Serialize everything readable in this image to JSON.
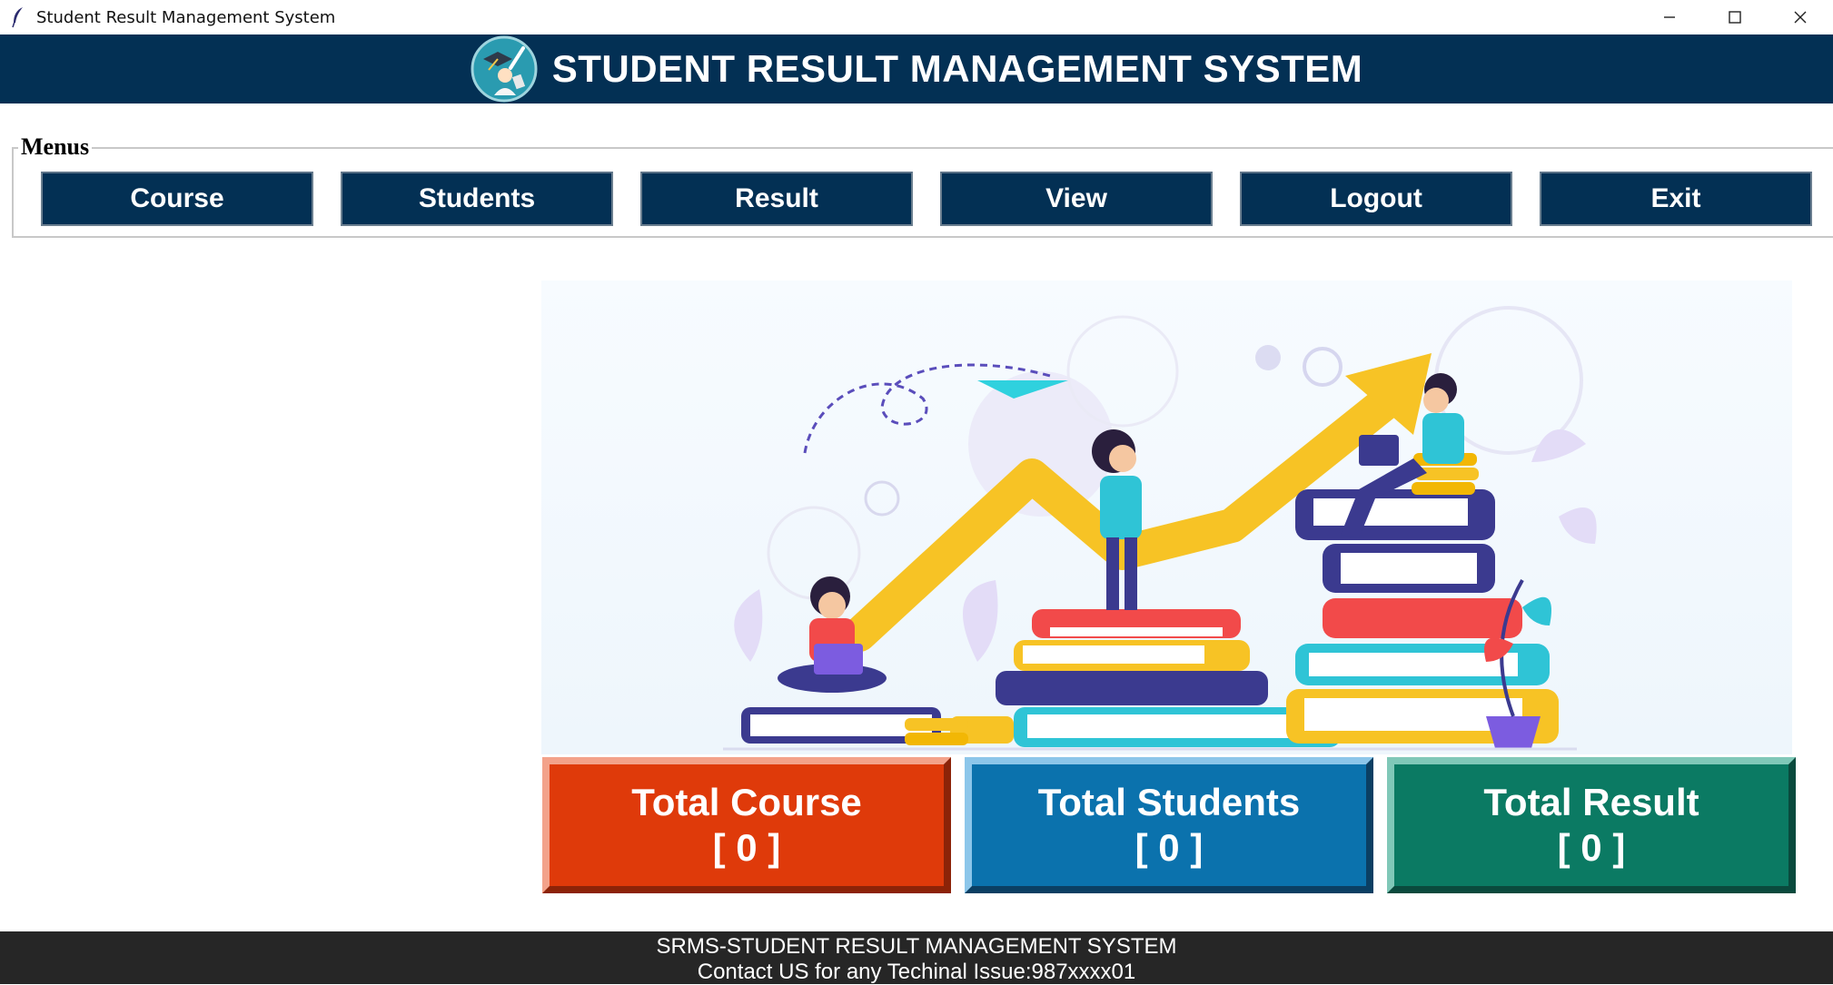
{
  "window": {
    "title": "Student Result Management System",
    "app_icon": "feather-icon",
    "controls": [
      "minimize-icon",
      "maximize-icon",
      "close-icon"
    ]
  },
  "header": {
    "title": "STUDENT RESULT MANAGEMENT SYSTEM",
    "logo_icon": "graduate-logo-icon",
    "background": "#033054"
  },
  "menus": {
    "legend": "Menus",
    "buttons": [
      "Course",
      "Students",
      "Result",
      "View",
      "Logout",
      "Exit"
    ]
  },
  "stats": [
    {
      "label": "Total Course",
      "value": "[ 0 ]",
      "color": "#df3a0a"
    },
    {
      "label": "Total Students",
      "value": "[ 0 ]",
      "color": "#0b72ad"
    },
    {
      "label": "Total Result",
      "value": "[ 0 ]",
      "color": "#0b7a63"
    }
  ],
  "footer": {
    "line1": "SRMS-STUDENT RESULT MANAGEMENT SYSTEM",
    "line2": "Contact US for any Techinal Issue:987xxxx01"
  }
}
